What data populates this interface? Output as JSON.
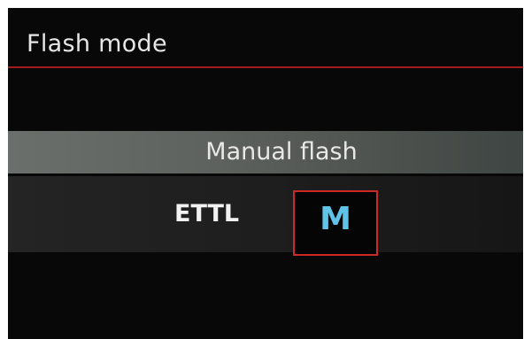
{
  "header": {
    "title": "Flash mode"
  },
  "current_value": {
    "label": "Manual flash"
  },
  "options": [
    {
      "label": "ETTL",
      "selected": false
    },
    {
      "label": "M",
      "selected": true
    }
  ],
  "colors": {
    "background": "#080808",
    "accent_rule": "#a11d1d",
    "selection_border": "#cc2929",
    "selected_text": "#62c3e8",
    "value_bar": "#5e625f"
  }
}
